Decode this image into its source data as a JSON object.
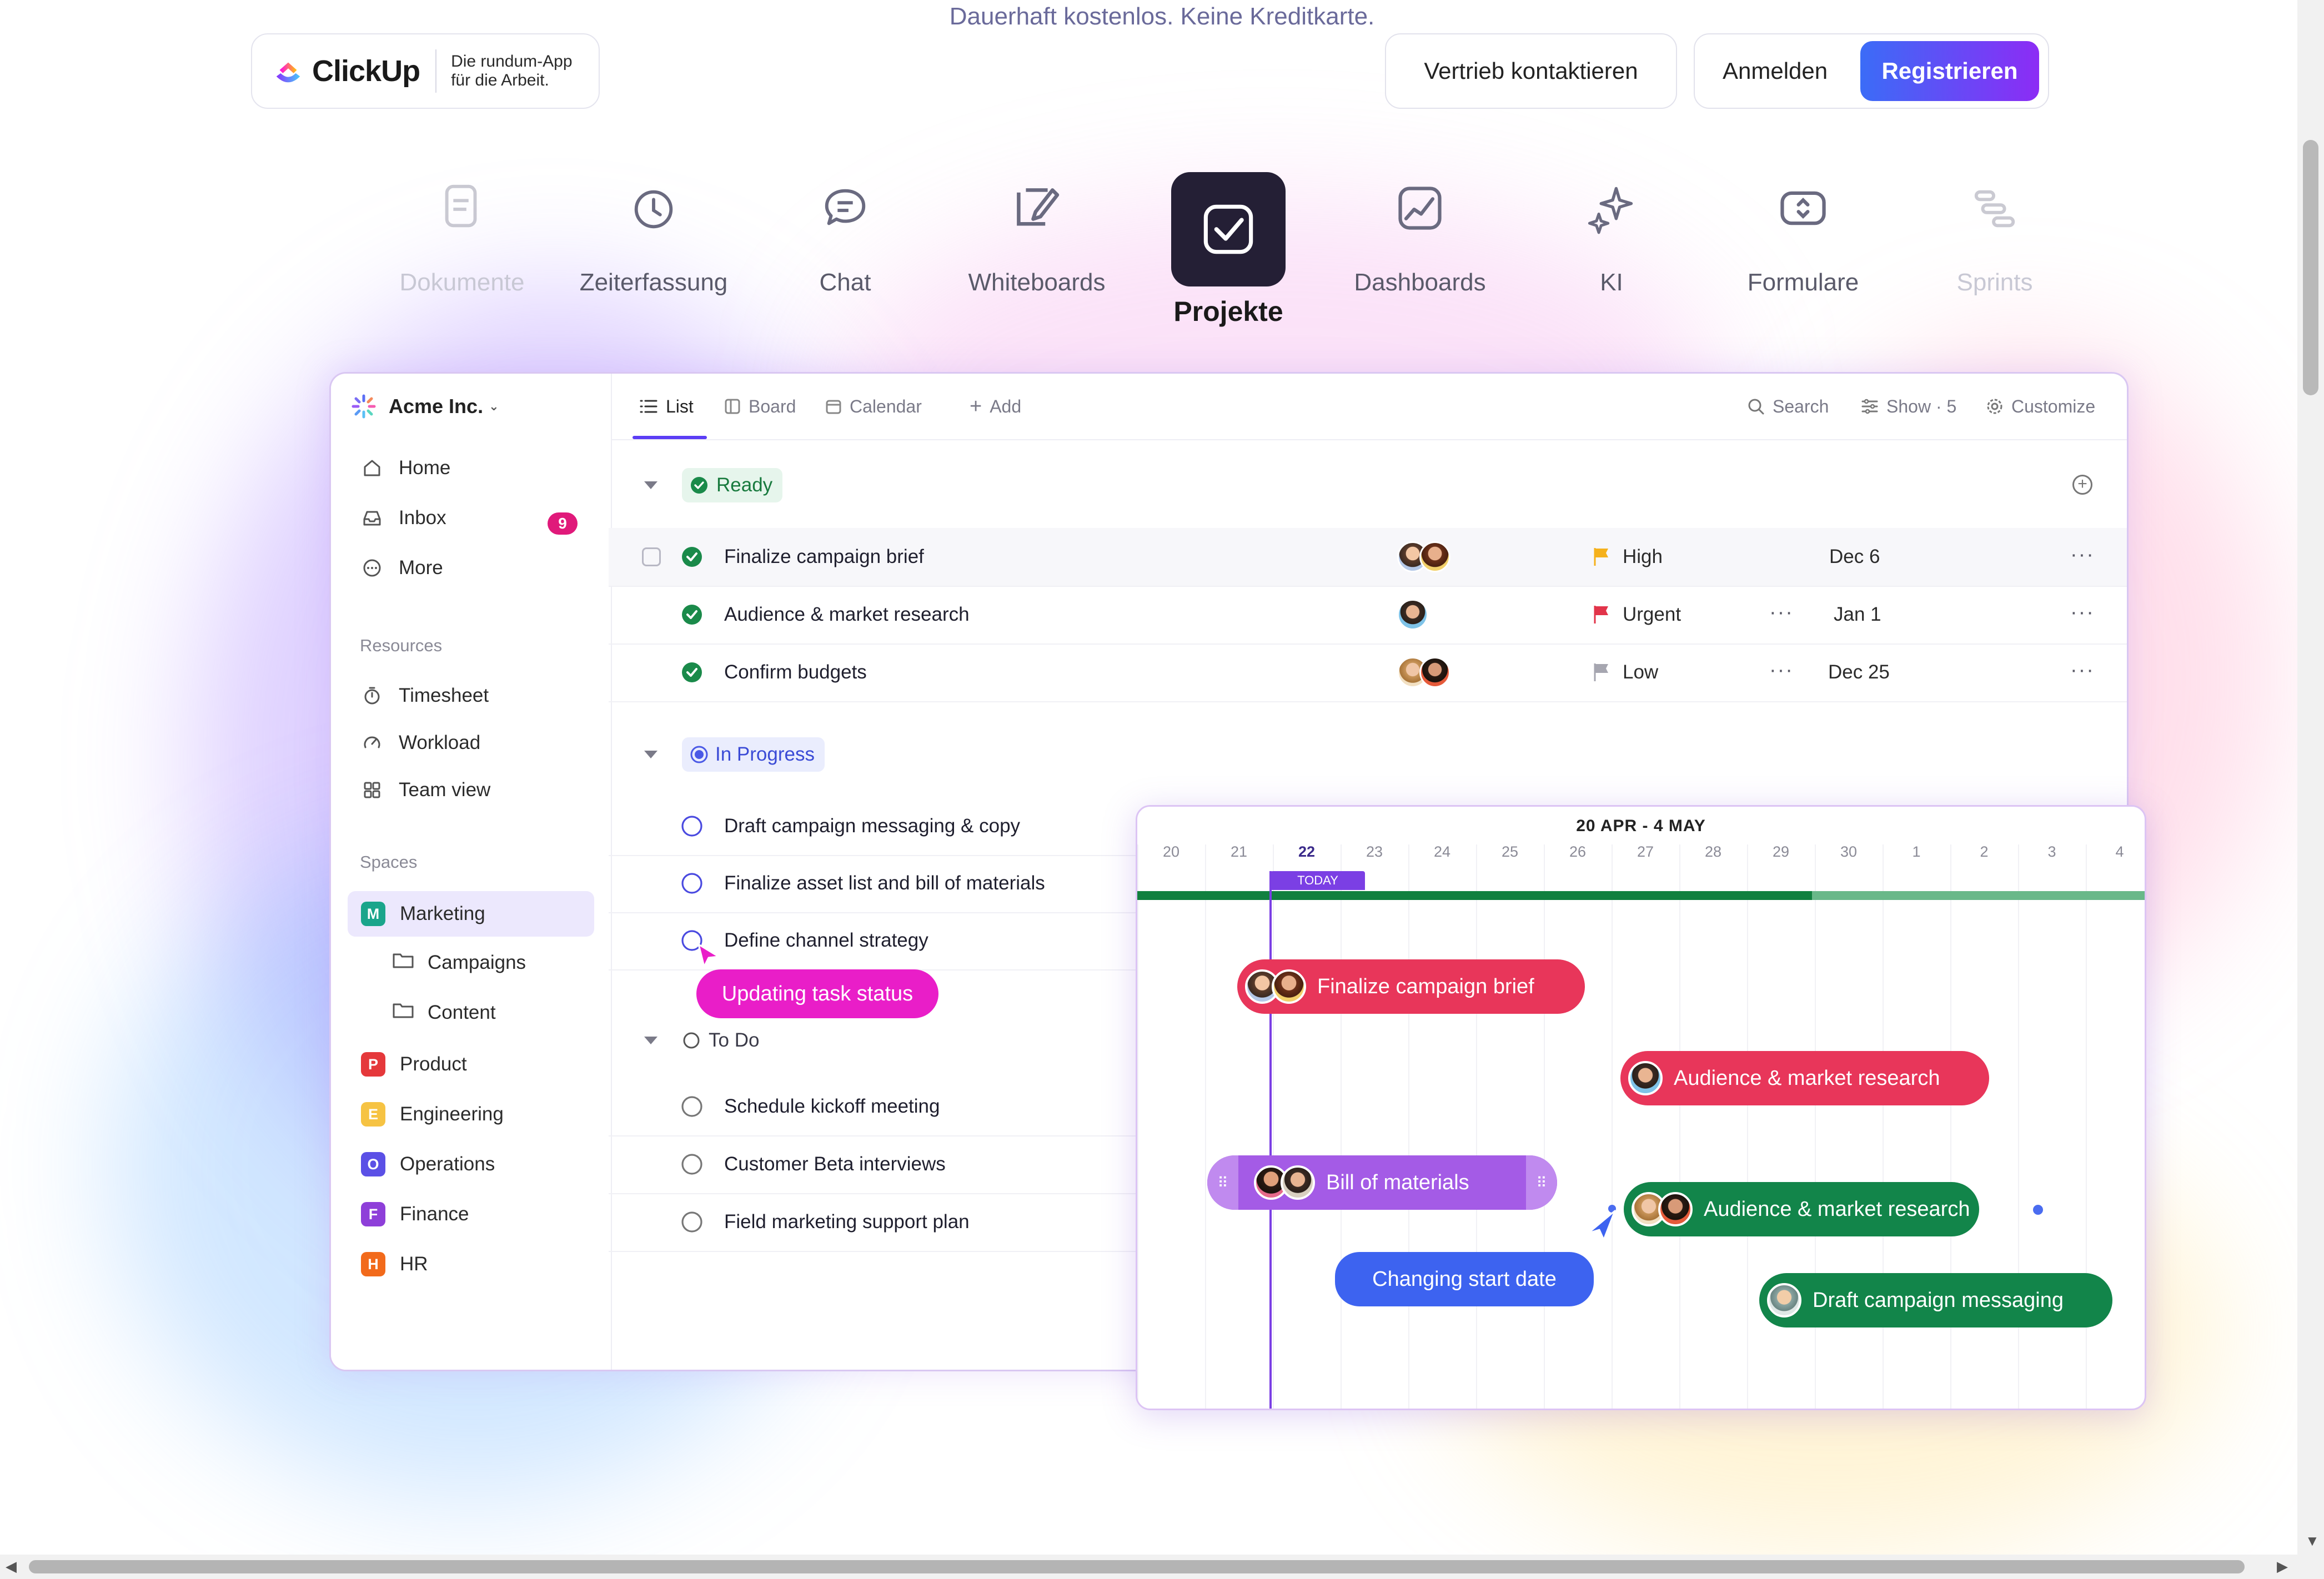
{
  "top_banner": "Dauerhaft kostenlos. Keine Kreditkarte.",
  "header": {
    "logo_word": "ClickUp",
    "tagline_line1": "Die rundum-App",
    "tagline_line2": "für die Arbeit.",
    "contact_sales": "Vertrieb kontaktieren",
    "login": "Anmelden",
    "register": "Registrieren"
  },
  "features": [
    {
      "label": "Dokumente",
      "icon": "document-icon",
      "state": "faded"
    },
    {
      "label": "Zeiterfassung",
      "icon": "clock-icon",
      "state": "normal"
    },
    {
      "label": "Chat",
      "icon": "chat-icon",
      "state": "normal"
    },
    {
      "label": "Whiteboards",
      "icon": "whiteboard-icon",
      "state": "normal"
    },
    {
      "label": "Projekte",
      "icon": "checkbox-icon",
      "state": "active"
    },
    {
      "label": "Dashboards",
      "icon": "dashboard-icon",
      "state": "normal"
    },
    {
      "label": "KI",
      "icon": "sparkle-icon",
      "state": "normal"
    },
    {
      "label": "Formulare",
      "icon": "form-icon",
      "state": "normal"
    },
    {
      "label": "Sprints",
      "icon": "sprints-icon",
      "state": "faded"
    }
  ],
  "app": {
    "workspace": "Acme Inc.",
    "nav": {
      "home": "Home",
      "inbox": "Inbox",
      "inbox_count": "9",
      "more": "More"
    },
    "resources_heading": "Resources",
    "resources": [
      "Timesheet",
      "Workload",
      "Team view"
    ],
    "spaces_heading": "Spaces",
    "spaces": [
      {
        "letter": "M",
        "name": "Marketing",
        "color": "#1aa58b"
      },
      {
        "letter": "P",
        "name": "Product",
        "color": "#e5383b"
      },
      {
        "letter": "E",
        "name": "Engineering",
        "color": "#f6c343"
      },
      {
        "letter": "O",
        "name": "Operations",
        "color": "#5b50e6"
      },
      {
        "letter": "F",
        "name": "Finance",
        "color": "#8e3fd9"
      },
      {
        "letter": "H",
        "name": "HR",
        "color": "#f26a1b"
      }
    ],
    "marketing_children": [
      "Campaigns",
      "Content"
    ],
    "views": {
      "list": "List",
      "board": "Board",
      "calendar": "Calendar",
      "add": "Add",
      "search": "Search",
      "show": "Show · 5",
      "customize": "Customize"
    },
    "groups": {
      "ready": "Ready",
      "in_progress": "In Progress",
      "todo": "To Do"
    },
    "ready_tasks": [
      {
        "name": "Finalize campaign brief",
        "priority": "High",
        "flag_color": "#f5b11c",
        "due": "Dec 6"
      },
      {
        "name": "Audience & market research",
        "priority": "Urgent",
        "flag_color": "#e2344a",
        "due": "Jan 1"
      },
      {
        "name": "Confirm budgets",
        "priority": "Low",
        "flag_color": "#a6a6b0",
        "due": "Dec 25"
      }
    ],
    "in_progress_tasks": [
      "Draft campaign messaging & copy",
      "Finalize asset list and bill of materials",
      "Define channel strategy"
    ],
    "todo_tasks": [
      "Schedule kickoff meeting",
      "Customer Beta interviews",
      "Field marketing support plan"
    ],
    "status_tooltip": "Updating task status"
  },
  "gantt": {
    "range": "20 APR - 4 MAY",
    "days": [
      "20",
      "21",
      "22",
      "23",
      "24",
      "25",
      "26",
      "27",
      "28",
      "29",
      "30",
      "1",
      "2",
      "3",
      "4"
    ],
    "today_label": "TODAY",
    "today_day": "22",
    "progress_fraction": 0.67,
    "bars": [
      {
        "label": "Finalize campaign brief",
        "color": "#e8365a"
      },
      {
        "label": "Audience & market research",
        "color": "#e8365a"
      },
      {
        "label": "Bill of materials",
        "color": "#a45be6"
      },
      {
        "label": "Audience & market research",
        "color": "#12854a"
      },
      {
        "label": "Draft campaign messaging",
        "color": "#12854a"
      }
    ],
    "tooltip": "Changing start date"
  },
  "colors": {
    "accent_purple": "#5b3df5",
    "register_gradient_start": "#3b6cf7",
    "register_gradient_end": "#8c2cf5",
    "tooltip_pink": "#e91ec8",
    "tooltip_blue": "#3d63f0"
  }
}
